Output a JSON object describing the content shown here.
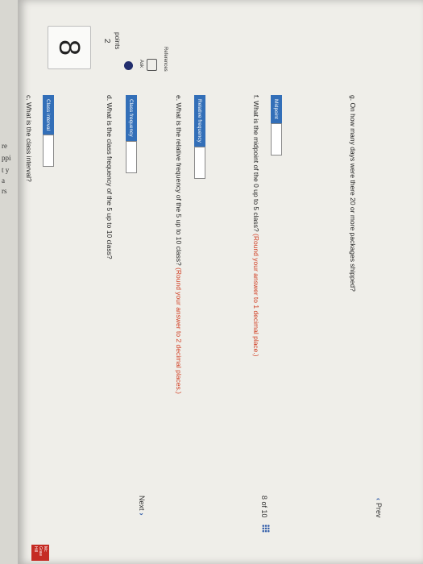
{
  "question": {
    "number": "8",
    "points_value": "2",
    "points_label": "points",
    "ask_label": "Ask",
    "references_label": "References"
  },
  "items": {
    "c": {
      "text": "c. What is the class interval?",
      "field_label": "Class interval"
    },
    "d": {
      "text": "d. What is the class frequency of the 5 up to 10 class?",
      "field_label": "Class frequency"
    },
    "e": {
      "text": "e. What is the relative frequency of the 5 up to 10 class?",
      "hint": "(Round your answer to 2 decimal places.)",
      "field_label": "Relative frequency"
    },
    "f": {
      "text": "f. What is the midpoint of the 0 up to 5 class?",
      "hint": "(Round your answer to 1 decimal place.)",
      "field_label": "Midpoint"
    },
    "g": {
      "text": "g. On how many days were there 20 or more packages shipped?"
    }
  },
  "nav": {
    "prev": "Prev",
    "page": "8",
    "of": "of 10",
    "next": "Next",
    "prev_chevron": "‹",
    "next_chevron": "›"
  },
  "logo": {
    "line1": "Mc",
    "line2": "Graw",
    "line3": "Hill"
  },
  "background_fragments": [
    "re",
    "ppi",
    "t y",
    "a",
    "rs"
  ],
  "colors": {
    "accent": "#336fb8",
    "hint_red": "#d03b1f",
    "ask_dot": "#222e6d"
  }
}
